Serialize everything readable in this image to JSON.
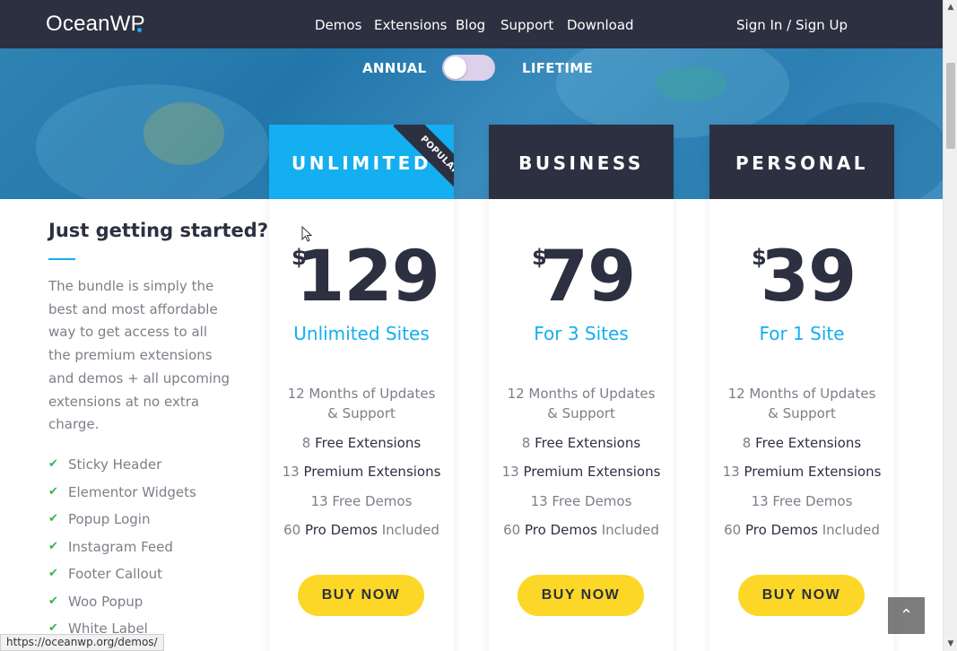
{
  "header": {
    "logo": "OceanWP",
    "nav": [
      "Demos",
      "Extensions",
      "Blog",
      "Support",
      "Download"
    ],
    "account_link": "Sign In / Sign Up"
  },
  "billing_toggle": {
    "left_label": "ANNUAL",
    "right_label": "LIFETIME",
    "is_lifetime": false
  },
  "intro": {
    "title": "Just getting started?",
    "text": "The bundle is simply the best and most affordable way to get access to all the premium extensions and demos + all upcoming extensions at no extra charge.",
    "features": [
      "Sticky Header",
      "Elementor Widgets",
      "Popup Login",
      "Instagram Feed",
      "Footer Callout",
      "Woo Popup",
      "White Label"
    ]
  },
  "plans": [
    {
      "name": "UNLIMITED",
      "badge": "POPULAR",
      "currency": "$",
      "price": "129",
      "sites": "Unlimited Sites",
      "updates": "12 Months of Updates & Support",
      "free_ext_count": "8",
      "free_ext_label": "Free Extensions",
      "premium_ext_count": "13",
      "premium_ext_label": "Premium Extensions",
      "free_demos": "13 Free Demos",
      "pro_demos_count": "60",
      "pro_demos_label": "Pro Demos",
      "pro_demos_suffix": "Included",
      "button": "BUY NOW"
    },
    {
      "name": "BUSINESS",
      "currency": "$",
      "price": "79",
      "sites": "For 3 Sites",
      "updates": "12 Months of Updates & Support",
      "free_ext_count": "8",
      "free_ext_label": "Free Extensions",
      "premium_ext_count": "13",
      "premium_ext_label": "Premium Extensions",
      "free_demos": "13 Free Demos",
      "pro_demos_count": "60",
      "pro_demos_label": "Pro Demos",
      "pro_demos_suffix": "Included",
      "button": "BUY NOW"
    },
    {
      "name": "PERSONAL",
      "currency": "$",
      "price": "39",
      "sites": "For 1 Site",
      "updates": "12 Months of Updates & Support",
      "free_ext_count": "8",
      "free_ext_label": "Free Extensions",
      "premium_ext_count": "13",
      "premium_ext_label": "Premium Extensions",
      "free_demos": "13 Free Demos",
      "pro_demos_count": "60",
      "pro_demos_label": "Pro Demos",
      "pro_demos_suffix": "Included",
      "button": "BUY NOW"
    }
  ],
  "status_bar": "https://oceanwp.org/demos/",
  "back_to_top_icon": "chevron-up-icon",
  "colors": {
    "header_bg": "#2c3040",
    "accent": "#13aff0",
    "button": "#fcd727",
    "check": "#33b34d"
  }
}
